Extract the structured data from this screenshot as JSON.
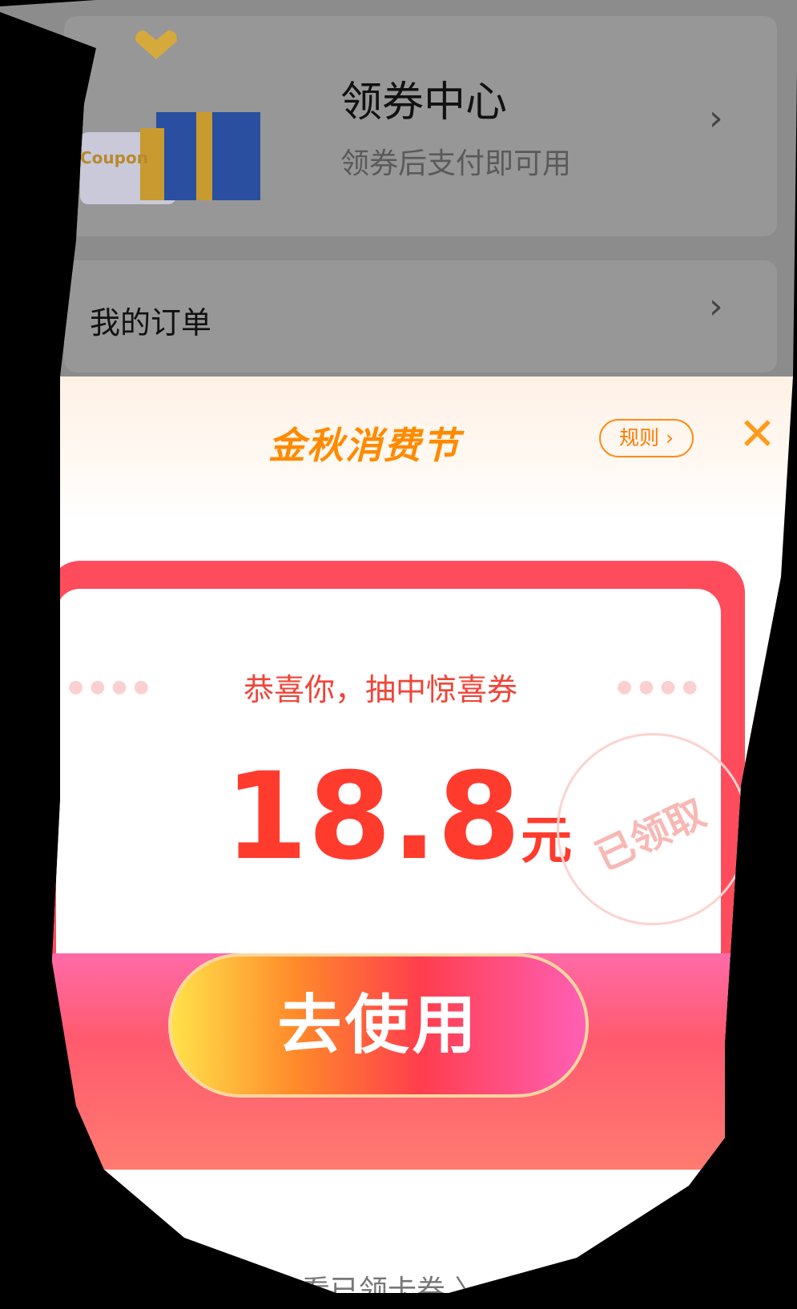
{
  "coupon_center": {
    "title": "领券中心",
    "subtitle": "领券后支付即可用",
    "image_label": "Coupon"
  },
  "orders": {
    "label": "我的订单"
  },
  "popup": {
    "title": "金秋消费节",
    "rules_label": "规则 ›",
    "close": "✕",
    "congrats": "恭喜你，抽中惊喜券",
    "amount": "18.8",
    "unit": "元",
    "stamp": "已领取",
    "use_button": "去使用",
    "view_link": "查看已领卡券 〉"
  },
  "colors": {
    "accent": "#ff8a00",
    "coupon_red": "#ff4c5d",
    "amount": "#ff3b2e"
  },
  "icons": {
    "chevron": "chevron-right-icon",
    "close": "close-icon"
  }
}
